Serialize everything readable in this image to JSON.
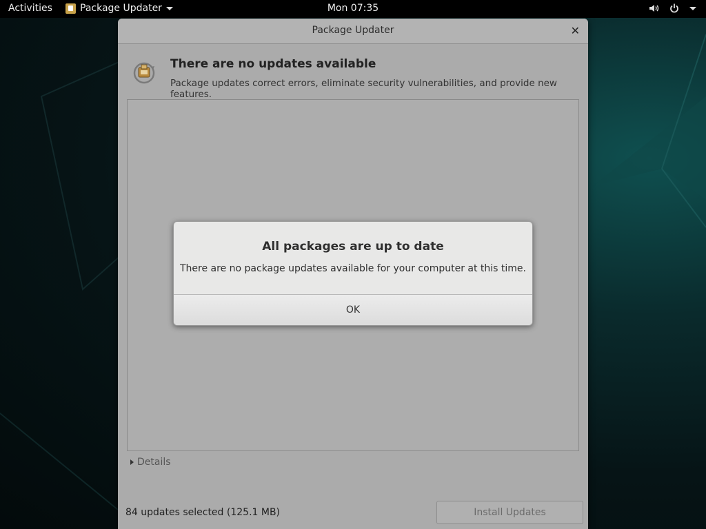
{
  "topbar": {
    "activities": "Activities",
    "app_name": "Package Updater",
    "clock": "Mon 07:35"
  },
  "window": {
    "title": "Package Updater",
    "heading": "There are no updates available",
    "subheading": "Package updates correct errors, eliminate security vulnerabilities, and provide new features.",
    "details_label": "Details",
    "selected_info": "84 updates selected (125.1 MB)",
    "install_label": "Install Updates"
  },
  "dialog": {
    "title": "All packages are up to date",
    "message": "There are no package updates available for your computer at this time.",
    "ok_label": "OK"
  }
}
